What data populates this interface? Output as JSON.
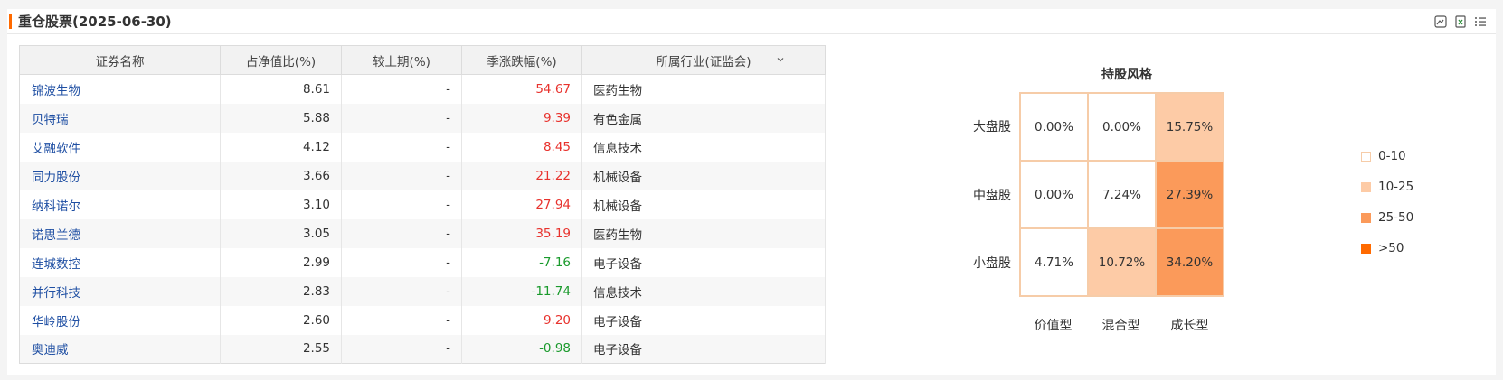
{
  "header": {
    "title": "重仓股票(2025-06-30)"
  },
  "table": {
    "columns": [
      "证券名称",
      "占净值比(%)",
      "较上期(%)",
      "季涨跌幅(%)",
      "所属行业(证监会)"
    ],
    "rows": [
      {
        "name": "锦波生物",
        "ratio": "8.61",
        "change": "-",
        "quarter": "54.67",
        "dir": "up",
        "industry": "医药生物"
      },
      {
        "name": "贝特瑞",
        "ratio": "5.88",
        "change": "-",
        "quarter": "9.39",
        "dir": "up",
        "industry": "有色金属"
      },
      {
        "name": "艾融软件",
        "ratio": "4.12",
        "change": "-",
        "quarter": "8.45",
        "dir": "up",
        "industry": "信息技术"
      },
      {
        "name": "同力股份",
        "ratio": "3.66",
        "change": "-",
        "quarter": "21.22",
        "dir": "up",
        "industry": "机械设备"
      },
      {
        "name": "纳科诺尔",
        "ratio": "3.10",
        "change": "-",
        "quarter": "27.94",
        "dir": "up",
        "industry": "机械设备"
      },
      {
        "name": "诺思兰德",
        "ratio": "3.05",
        "change": "-",
        "quarter": "35.19",
        "dir": "up",
        "industry": "医药生物"
      },
      {
        "name": "连城数控",
        "ratio": "2.99",
        "change": "-",
        "quarter": "-7.16",
        "dir": "down",
        "industry": "电子设备"
      },
      {
        "name": "并行科技",
        "ratio": "2.83",
        "change": "-",
        "quarter": "-11.74",
        "dir": "down",
        "industry": "信息技术"
      },
      {
        "name": "华岭股份",
        "ratio": "2.60",
        "change": "-",
        "quarter": "9.20",
        "dir": "up",
        "industry": "电子设备"
      },
      {
        "name": "奥迪威",
        "ratio": "2.55",
        "change": "-",
        "quarter": "-0.98",
        "dir": "down",
        "industry": "电子设备"
      }
    ]
  },
  "style_box": {
    "title": "持股风格",
    "rows": [
      "大盘股",
      "中盘股",
      "小盘股"
    ],
    "cols": [
      "价值型",
      "混合型",
      "成长型"
    ],
    "cells": [
      [
        {
          "text": "0.00%",
          "color": "#ffffff"
        },
        {
          "text": "0.00%",
          "color": "#ffffff"
        },
        {
          "text": "15.75%",
          "color": "#fdcba6"
        }
      ],
      [
        {
          "text": "0.00%",
          "color": "#ffffff"
        },
        {
          "text": "7.24%",
          "color": "#ffffff"
        },
        {
          "text": "27.39%",
          "color": "#fb9a5a"
        }
      ],
      [
        {
          "text": "4.71%",
          "color": "#ffffff"
        },
        {
          "text": "10.72%",
          "color": "#fdcba6"
        },
        {
          "text": "34.20%",
          "color": "#fb9a5a"
        }
      ]
    ],
    "legend": [
      {
        "label": "0-10",
        "color": "#ffffff",
        "border": "#f6cca8"
      },
      {
        "label": "10-25",
        "color": "#fdcba6",
        "border": "#fdcba6"
      },
      {
        "label": "25-50",
        "color": "#fb9a5a",
        "border": "#fb9a5a"
      },
      {
        "label": ">50",
        "color": "#ff6a00",
        "border": "#ff6a00"
      }
    ]
  },
  "colors": {
    "accent": "#ff6a00",
    "up": "#e8322d",
    "down": "#1a9a2c",
    "link": "#1f4fa3"
  },
  "icons": [
    "image-export-icon",
    "excel-export-icon",
    "list-icon"
  ]
}
